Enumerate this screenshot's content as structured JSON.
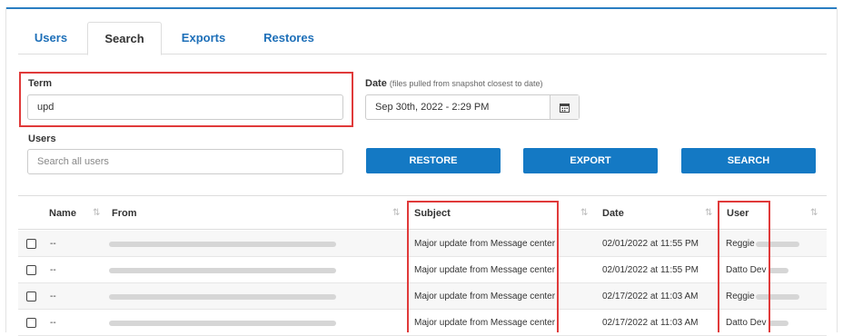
{
  "tabs": [
    {
      "label": "Users"
    },
    {
      "label": "Search"
    },
    {
      "label": "Exports"
    },
    {
      "label": "Restores"
    }
  ],
  "active_tab": "Search",
  "term": {
    "label": "Term",
    "value": "upd"
  },
  "date": {
    "label": "Date",
    "hint": "(files pulled from snapshot closest to date)",
    "value": "Sep 30th, 2022 - 2:29 PM"
  },
  "users": {
    "label": "Users",
    "placeholder": "Search all users"
  },
  "buttons": {
    "restore": "RESTORE",
    "export": "EXPORT",
    "search": "SEARCH"
  },
  "table": {
    "headers": {
      "name": "Name",
      "from": "From",
      "subject": "Subject",
      "date": "Date",
      "user": "User"
    },
    "rows": [
      {
        "name": "--",
        "subject": "Major update from Message center",
        "date": "02/01/2022 at 11:55 PM",
        "user": "Reggie"
      },
      {
        "name": "--",
        "subject": "Major update from Message center",
        "date": "02/01/2022 at 11:55 PM",
        "user": "Datto Dev"
      },
      {
        "name": "--",
        "subject": "Major update from Message center",
        "date": "02/17/2022 at 11:03 AM",
        "user": "Reggie"
      },
      {
        "name": "--",
        "subject": "Major update from Message center",
        "date": "02/17/2022 at 11:03 AM",
        "user": "Datto Dev"
      }
    ]
  },
  "colors": {
    "accent": "#1479c4",
    "tab_text": "#1d6fb8",
    "highlight_box": "#e03a3a"
  }
}
